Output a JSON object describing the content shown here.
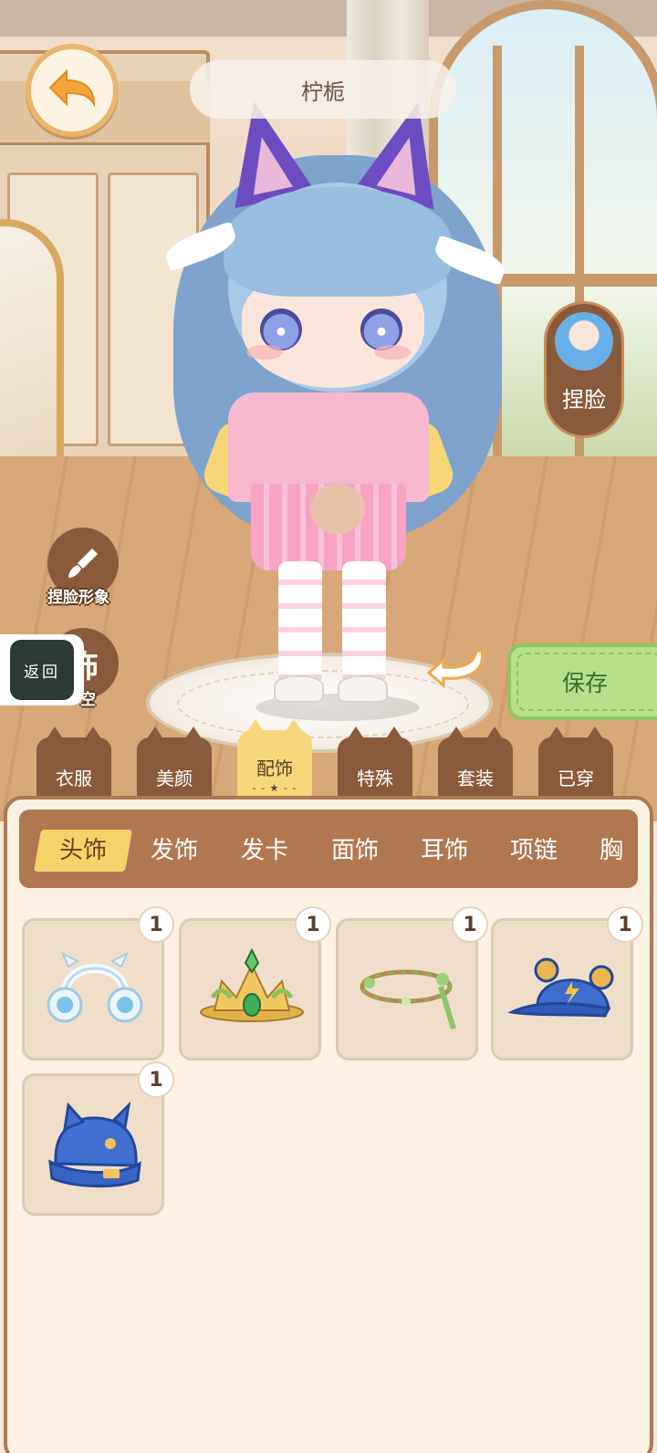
{
  "header": {
    "character_name": "柠栀"
  },
  "side_buttons": {
    "face_edit_label": "捏脸",
    "pinch_image_label": "捏脸形象",
    "clear_label_partial": "空",
    "clear_icon_glyph": "饰",
    "return_label": "返回"
  },
  "save_label": "保存",
  "categories": [
    {
      "label": "衣服"
    },
    {
      "label": "美颜"
    },
    {
      "label": "配饰",
      "active": true,
      "stars": "- - ★ - -"
    },
    {
      "label": "特殊"
    },
    {
      "label": "套装"
    },
    {
      "label": "已穿"
    }
  ],
  "subcategories": [
    {
      "label": "头饰",
      "active": true
    },
    {
      "label": "发饰"
    },
    {
      "label": "发卡"
    },
    {
      "label": "面饰"
    },
    {
      "label": "耳饰"
    },
    {
      "label": "项链"
    },
    {
      "label": "胸"
    }
  ],
  "items": [
    {
      "icon": "earmuffs-icon",
      "count": "1"
    },
    {
      "icon": "golden-crown-icon",
      "count": "1"
    },
    {
      "icon": "vine-wreath-icon",
      "count": "1"
    },
    {
      "icon": "blue-bear-cap-icon",
      "count": "1"
    },
    {
      "icon": "blue-cat-beanie-icon",
      "count": "1"
    }
  ],
  "colors": {
    "tab_brown": "#8a5a3c",
    "active_yellow": "#f6d77c",
    "save_green": "#b6e08a",
    "panel_bg": "#fdf1e3"
  }
}
